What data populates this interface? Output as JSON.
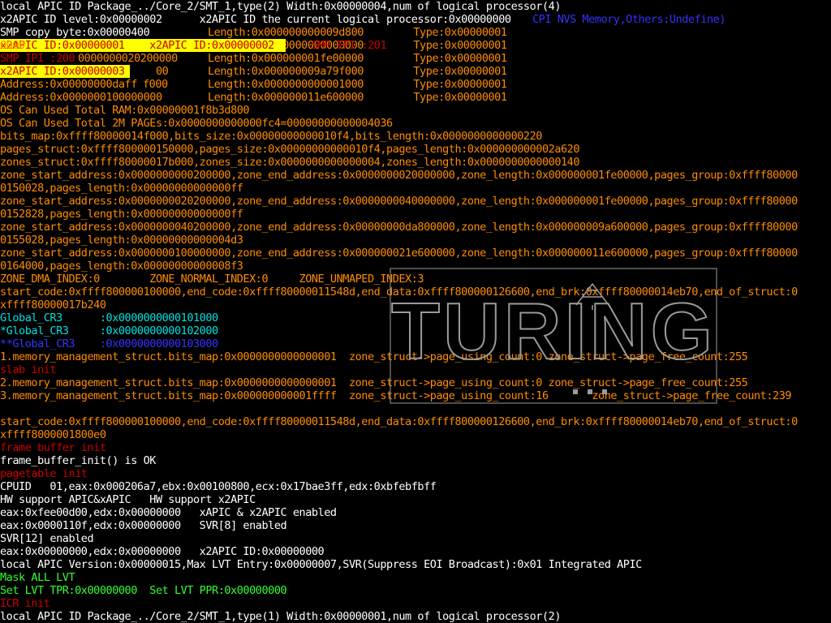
{
  "colors": {
    "white": "#ffffff",
    "orange": "#ff8c00",
    "red": "#cc0000",
    "cyan": "#00e0e0",
    "blue": "#3333ff",
    "green": "#33ff33",
    "highlight": "#ffff00",
    "watermark": "#9a9a9a"
  },
  "watermark": {
    "text": "TURING",
    "icon": "tree-logo-icon"
  },
  "layers": {
    "base": [
      {
        "row": 0,
        "color": "white",
        "text": "local APIC ID Package_../Core_2/SMT_1,type(2) Width:0x00000004,num of logical processor(4)"
      },
      {
        "row": 1,
        "color": "white",
        "text": "x2APIC ID level:0x00000002      x2APIC ID the current logical processor:0x00000000"
      },
      {
        "row": 2,
        "color": "white",
        "text": "SMP copy byte:0x00000400"
      },
      {
        "row": 6,
        "color": "orange",
        "text": "Address:0x00000000daff"
      },
      {
        "row": 7,
        "color": "orange",
        "text": "Address:0x0000000100000000"
      },
      {
        "row": 8,
        "color": "orange",
        "text": "OS Can Used Total RAM:0x00000001f8b3d800"
      },
      {
        "row": 9,
        "color": "orange",
        "text": "OS Can Used Total 2M PAGEs:0x0000000000000fc4=00000000000004036"
      },
      {
        "row": 10,
        "color": "orange",
        "text": "bits_map:0xffff80000014f000,bits_size:0x00000000000010f4,bits_length:0x0000000000000220"
      },
      {
        "row": 11,
        "color": "orange",
        "text": "pages_struct:0xffff800000150000,pages_size:0x00000000000010f4,pages_length:0x000000000002a620"
      },
      {
        "row": 12,
        "color": "orange",
        "text": "zones_struct:0xffff80000017b000,zones_size:0x0000000000000004,zones_length:0x0000000000000140"
      },
      {
        "row": 13,
        "color": "orange",
        "text": "zone_start_address:0x0000000000200000,zone_end_address:0x0000000020000000,zone_length:0x000000001fe00000,pages_group:0xffff80000"
      },
      {
        "row": 14,
        "color": "orange",
        "text": "0150028,pages_length:0x00000000000000ff"
      },
      {
        "row": 15,
        "color": "orange",
        "text": "zone_start_address:0x0000000020200000,zone_end_address:0x0000000040000000,zone_length:0x000000001fe00000,pages_group:0xffff80000"
      },
      {
        "row": 16,
        "color": "orange",
        "text": "0152828,pages_length:0x00000000000000ff"
      },
      {
        "row": 17,
        "color": "orange",
        "text": "zone_start_address:0x0000000040200000,zone_end_address:0x00000000da800000,zone_length:0x000000009a600000,pages_group:0xffff80000"
      },
      {
        "row": 18,
        "color": "orange",
        "text": "0155028,pages_length:0x00000000000004d3"
      },
      {
        "row": 19,
        "color": "orange",
        "text": "zone_start_address:0x0000000100000000,zone_end_address:0x000000021e600000,zone_length:0x000000011e600000,pages_group:0xffff80000"
      },
      {
        "row": 20,
        "color": "orange",
        "text": "0164000,pages_length:0x00000000000008f3"
      },
      {
        "row": 21,
        "color": "orange",
        "text": "ZONE_DMA_INDEX:0        ZONE_NORMAL_INDEX:0     ZONE_UNMAPED_INDEX:3"
      },
      {
        "row": 22,
        "color": "orange",
        "text": "start_code:0xffff800000100000,end_code:0xffff80000011548d,end_data:0xffff800000126600,end_brk:0xffff80000014eb70,end_of_struct:0"
      },
      {
        "row": 23,
        "color": "orange",
        "text": "xffff80000017b240"
      },
      {
        "row": 24,
        "color": "cyan",
        "text": "Global_CR3      :0x0000000000101000"
      },
      {
        "row": 25,
        "color": "cyan",
        "text": "*Global_CR3     :0x0000000000102000"
      },
      {
        "row": 26,
        "color": "blue",
        "text": "**Global_CR3    :0x0000000000103000"
      },
      {
        "row": 27,
        "color": "orange",
        "text": "1.memory_management_struct.bits_map:0x0000000000000001  zone_struct->page_using_count:0 zone_struct->page_free_count:255"
      },
      {
        "row": 28,
        "color": "red",
        "text": "slab init"
      },
      {
        "row": 29,
        "color": "orange",
        "text": "2.memory_management_struct.bits_map:0x0000000000000001  zone_struct->page_using_count:0 zone_struct->page_free_count:255"
      },
      {
        "row": 30,
        "color": "orange",
        "text": "3.memory_management_struct.bits_map:0x000000000001ffff  zone_struct->page_using_count:16       zone_struct->page_free_count:239"
      },
      {
        "row": 32,
        "color": "orange",
        "text": "start_code:0xffff800000100000,end_code:0xffff80000011548d,end_data:0xffff800000126600,end_brk:0xffff80000014eb70,end_of_struct:0"
      },
      {
        "row": 33,
        "color": "orange",
        "text": "xffff8000001800e0"
      },
      {
        "row": 34,
        "color": "red",
        "text": "frame buffer init"
      },
      {
        "row": 35,
        "color": "white",
        "text": "frame_buffer_init() is OK"
      },
      {
        "row": 36,
        "color": "red",
        "text": "pagetable init"
      },
      {
        "row": 37,
        "color": "white",
        "text": "CPUID   01,eax:0x000206a7,ebx:0x00100800,ecx:0x17bae3ff,edx:0xbfebfbff"
      },
      {
        "row": 38,
        "color": "white",
        "text": "HW support APIC&xAPIC   HW support x2APIC"
      },
      {
        "row": 39,
        "color": "white",
        "text": "eax:0xfee00d00,edx:0x00000000   xAPIC & x2APIC enabled"
      },
      {
        "row": 40,
        "color": "white",
        "text": "eax:0x0000110f,edx:0x00000000   SVR[8] enabled"
      },
      {
        "row": 41,
        "color": "white",
        "text": "SVR[12] enabled"
      },
      {
        "row": 42,
        "color": "white",
        "text": "eax:0x00000000,edx:0x00000000   x2APIC ID:0x00000000"
      },
      {
        "row": 43,
        "color": "white",
        "text": "local APIC Version:0x00000015,Max LVT Entry:0x00000007,SVR(Suppress EOI Broadcast):0x01 Integrated APIC"
      },
      {
        "row": 44,
        "color": "green",
        "text": "Mask ALL LVT"
      },
      {
        "row": 45,
        "color": "green",
        "text": "Set LVT TPR:0x00000000  Set LVT PPR:0x00000000"
      },
      {
        "row": 46,
        "color": "red",
        "text": "ICR init"
      },
      {
        "row": 47,
        "color": "white",
        "text": "local APIC ID Package_../Core_2/SMT_1,type(1) Width:0x00000001,num of logical processor(2)"
      }
    ],
    "mid": [
      {
        "row": 2,
        "col": 32,
        "color": "orange",
        "text": "Length:0x000000000009d800        Type:0x00000001"
      },
      {
        "row": 3,
        "col": 32,
        "color": "orange",
        "text": "Length:0x0000000000000000        Type:0x00000001"
      },
      {
        "row": 4,
        "col": 32,
        "color": "orange",
        "text": "Length:0x000000001fe00000        Type:0x00000001"
      },
      {
        "row": 5,
        "col": 32,
        "color": "orange",
        "text": "Length:0x000000009a79f000        Type:0x00000001"
      },
      {
        "row": 6,
        "col": 32,
        "color": "orange",
        "text": "Length:0x0000000000001000        Type:0x00000001"
      },
      {
        "row": 7,
        "col": 32,
        "color": "orange",
        "text": "Length:0x000000011e600000        Type:0x00000001"
      },
      {
        "row": 1,
        "col": 82,
        "color": "blue",
        "text": "CPI NVS Memory,Others:Undefine)"
      },
      {
        "row": 6,
        "col": 22,
        "color": "orange",
        "text": "f000"
      },
      {
        "row": 5,
        "col": 24,
        "color": "orange",
        "text": "00"
      }
    ],
    "top": [
      {
        "row": 3,
        "col": 0,
        "color": "orange",
        "text": "0000"
      },
      {
        "row": 3,
        "col": 48,
        "color": "red",
        "text": "SMP IPI :201"
      },
      {
        "row": 4,
        "col": 0,
        "color": "red",
        "text": "SMP IPI :200"
      },
      {
        "row": 4,
        "col": 12,
        "color": "orange",
        "text": "0000000020200000"
      }
    ],
    "highlights": [
      {
        "row": 3,
        "col": 0,
        "color": "red",
        "bg": "highlight",
        "text": "x2APIC ID:0x00000001    x2APIC ID:0x00000002"
      },
      {
        "row": 5,
        "col": 0,
        "color": "red",
        "bg": "highlight",
        "text": "x2APIC ID:0x00000003"
      }
    ]
  }
}
